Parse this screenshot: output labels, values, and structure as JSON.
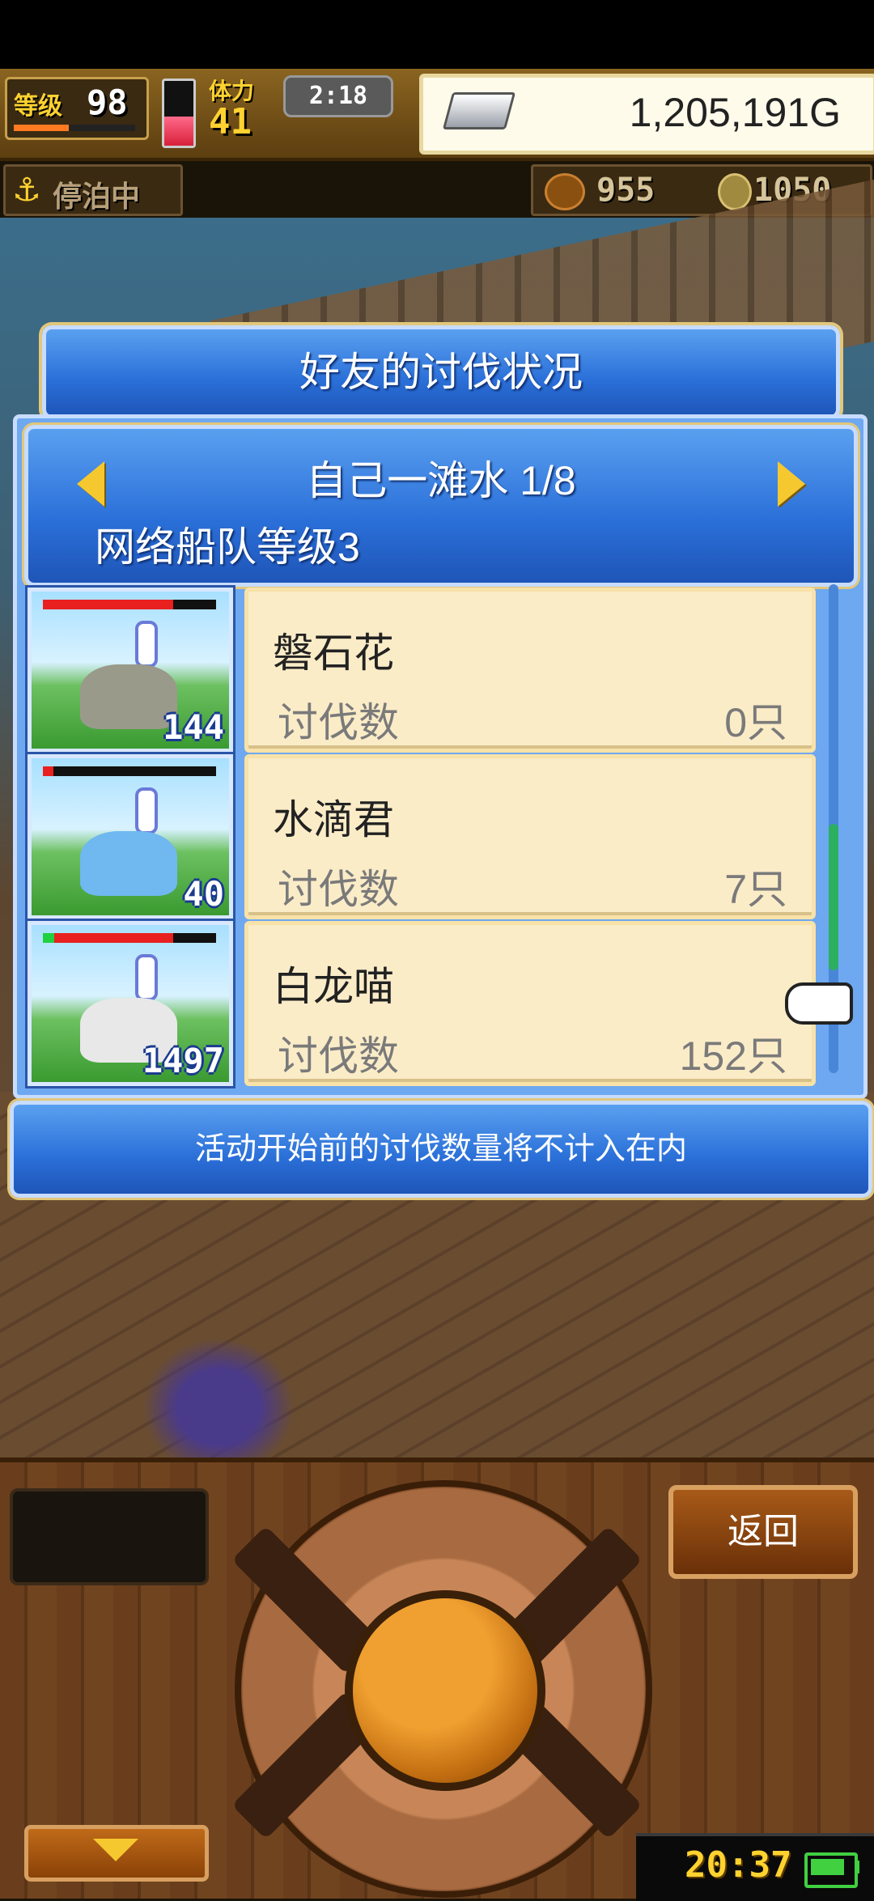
{
  "hud": {
    "level_label": "等级",
    "level_value": "98",
    "level_progress": 0.45,
    "hp_fill": 0.45,
    "stamina_label": "体力",
    "stamina_value": "41",
    "timer": "2:18",
    "gold": "1,205,191G",
    "dock_status": "停泊中",
    "resource_1": "955",
    "resource_2": "1050"
  },
  "panel": {
    "title": "好友的讨伐状况",
    "friend_name": "自己一滩水 1/8",
    "fleet_level": "网络船队等级3"
  },
  "monsters": [
    {
      "name": "磐石花",
      "kill_label": "讨伐数",
      "kill_count": "0只",
      "level": "144",
      "hp": 0.75,
      "has_green": false,
      "color": "#9a9a8a"
    },
    {
      "name": "水滴君",
      "kill_label": "讨伐数",
      "kill_count": "7只",
      "level": "40",
      "hp": 0.06,
      "has_green": false,
      "color": "#70b8f0"
    },
    {
      "name": "白龙喵",
      "kill_label": "讨伐数",
      "kill_count": "152只",
      "level": "1497",
      "hp": 0.75,
      "has_green": true,
      "color": "#e8e8e8"
    }
  ],
  "scroll": {
    "position": 0.7,
    "size": 0.3
  },
  "notice": "活动开始前的讨伐数量将不计入在内",
  "controls": {
    "back_label": "返回",
    "clock": "20:37",
    "battery_level": 0.9
  },
  "colors": {
    "panel_blue": "#2a6fd8",
    "info_bg": "#fbecc8",
    "gold_text": "#ffd230"
  },
  "icons": [
    "anchor-icon",
    "silver-bar-icon",
    "meat-icon",
    "coin-icon",
    "arrow-left-icon",
    "arrow-right-icon",
    "pointer-hand-icon",
    "down-arrow-icon",
    "battery-icon"
  ]
}
